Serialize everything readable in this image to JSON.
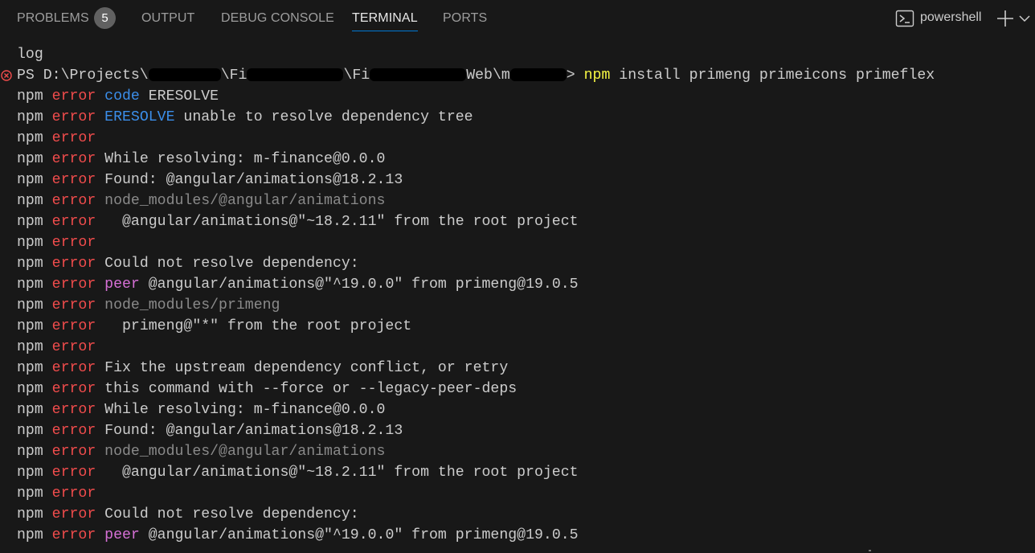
{
  "tabs": [
    {
      "label": "PROBLEMS",
      "badge": "5",
      "active": false
    },
    {
      "label": "OUTPUT",
      "active": false
    },
    {
      "label": "DEBUG CONSOLE",
      "active": false
    },
    {
      "label": "TERMINAL",
      "active": true
    },
    {
      "label": "PORTS",
      "active": false
    }
  ],
  "shell": {
    "name": "powershell"
  },
  "colors": {
    "background": "#181818",
    "error": "#f14c4c",
    "blue": "#3b8eea",
    "grey": "#8a8a8a",
    "magenta": "#d670d6",
    "yellow": "#f5f543",
    "accent": "#0078d4"
  },
  "terminal": {
    "log_line": "log",
    "prompt": {
      "prefix": "PS D:\\Projects\\",
      "seg1": "\\Fi",
      "seg2": "\\Fi",
      "seg3": "Web\\m",
      "suffix": "> ",
      "command_npm": "npm",
      "command_rest": " install primeng primeicons primeflex"
    },
    "npm": "npm",
    "error": "error",
    "lines": [
      [
        {
          "t": "code",
          "c": "blue"
        },
        {
          "t": " ERESOLVE",
          "c": "plain"
        }
      ],
      [
        {
          "t": "ERESOLVE",
          "c": "blue"
        },
        {
          "t": " unable to resolve dependency tree",
          "c": "plain"
        }
      ],
      [],
      [
        {
          "t": "While resolving: m-finance@0.0.0",
          "c": "plain"
        }
      ],
      [
        {
          "t": "Found: @angular/animations@18.2.13",
          "c": "plain"
        }
      ],
      [
        {
          "t": "node_modules/@angular/animations",
          "c": "grey"
        }
      ],
      [
        {
          "t": "  @angular/animations@\"~18.2.11\" from the root project",
          "c": "plain"
        }
      ],
      [],
      [
        {
          "t": "Could not resolve dependency:",
          "c": "plain"
        }
      ],
      [
        {
          "t": "peer",
          "c": "magenta"
        },
        {
          "t": " @angular/animations@\"^19.0.0\" from primeng@19.0.5",
          "c": "plain"
        }
      ],
      [
        {
          "t": "node_modules/primeng",
          "c": "grey"
        }
      ],
      [
        {
          "t": "  primeng@\"*\" from the root project",
          "c": "plain"
        }
      ],
      [],
      [
        {
          "t": "Fix the upstream dependency conflict, or retry",
          "c": "plain"
        }
      ],
      [
        {
          "t": "this command with --force or --legacy-peer-deps",
          "c": "plain"
        }
      ],
      [
        {
          "t": "While resolving: m-finance@0.0.0",
          "c": "plain"
        }
      ],
      [
        {
          "t": "Found: @angular/animations@18.2.13",
          "c": "plain"
        }
      ],
      [
        {
          "t": "node_modules/@angular/animations",
          "c": "grey"
        }
      ],
      [
        {
          "t": "  @angular/animations@\"~18.2.11\" from the root project",
          "c": "plain"
        }
      ],
      [],
      [
        {
          "t": "Could not resolve dependency:",
          "c": "plain"
        }
      ],
      [
        {
          "t": "peer",
          "c": "magenta"
        },
        {
          "t": " @angular/animations@\"^19.0.0\" from primeng@19.0.5",
          "c": "plain"
        }
      ]
    ]
  }
}
